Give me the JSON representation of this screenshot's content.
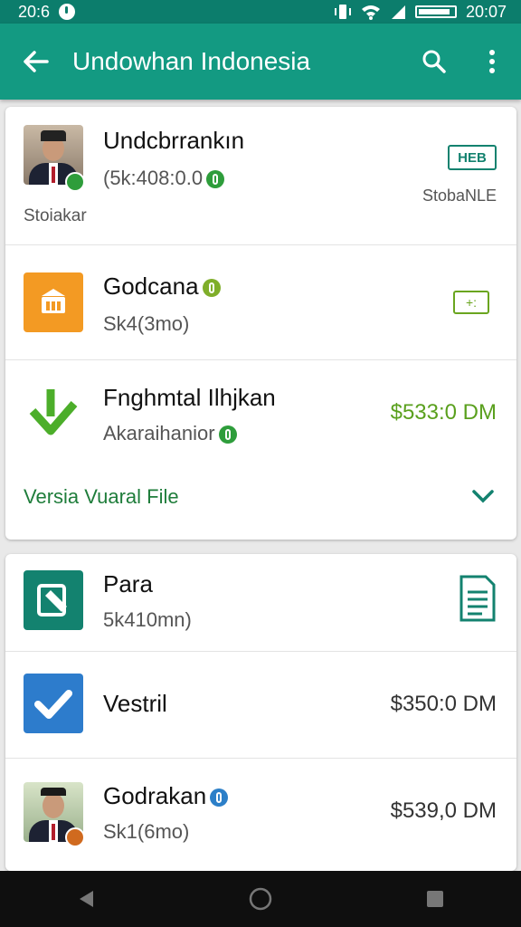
{
  "status_bar": {
    "time_left": "20:6",
    "time_right": "20:07"
  },
  "app_bar": {
    "title": "Undowhan Indonesia"
  },
  "card1": {
    "items": [
      {
        "name": "Undcbrrankın",
        "sub": "(5k:408:0.0",
        "caption": "Stoiakar",
        "badge": "HEB",
        "badge_caption": "StobaNLE"
      },
      {
        "name": "Godcana",
        "sub": "Sk4(3mo)",
        "badge": "+:"
      },
      {
        "name": "Fnghmtal Ilhjkan",
        "sub": "Akaraihanior",
        "amount": "$533:0 DM"
      }
    ],
    "footer_link": "Versia Vuaral File"
  },
  "card2": {
    "items": [
      {
        "name": "Para",
        "sub": "5k410mn)"
      },
      {
        "name": "Vestril",
        "amount": "$350:0 DM"
      },
      {
        "name": "Godrakan",
        "sub": "Sk1(6mo)",
        "amount": "$539,0 DM"
      }
    ]
  },
  "colors": {
    "app_bar": "#139a82",
    "status_bar": "#0c7d6c",
    "accent_green": "#2e9d3b",
    "amount_green": "#5aa01e",
    "orange": "#f39a23",
    "teal": "#13826f",
    "blue": "#2d7ccc"
  }
}
